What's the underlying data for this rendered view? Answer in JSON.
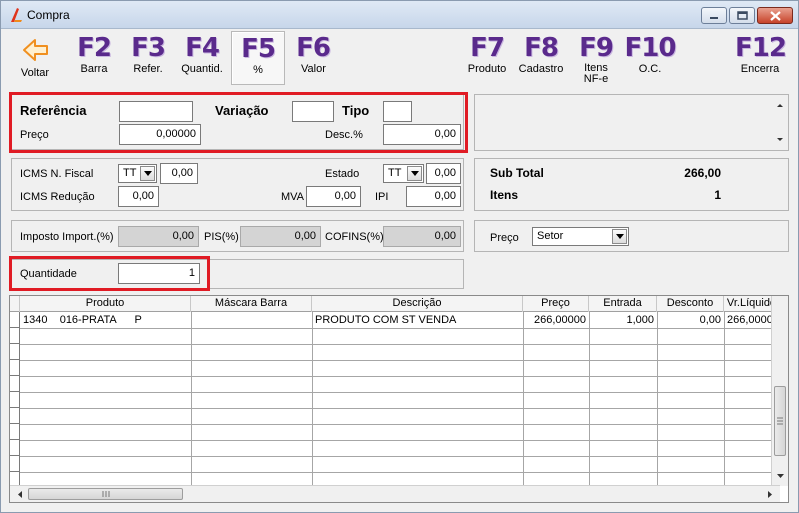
{
  "window": {
    "title": "Compra"
  },
  "toolbar": [
    {
      "key": "",
      "label": "Voltar"
    },
    {
      "key": "F2",
      "label": "Barra"
    },
    {
      "key": "F3",
      "label": "Refer."
    },
    {
      "key": "F4",
      "label": "Quantid."
    },
    {
      "key": "F5",
      "label": "%"
    },
    {
      "key": "F6",
      "label": "Valor"
    },
    {
      "key": "F7",
      "label": "Produto"
    },
    {
      "key": "F8",
      "label": "Cadastro"
    },
    {
      "key": "F9",
      "label": "Itens",
      "label2": "NF-e"
    },
    {
      "key": "F10",
      "label": "O.C."
    },
    {
      "key": "F12",
      "label": "Encerra"
    }
  ],
  "product": {
    "referencia_label": "Referência",
    "referencia_value": "",
    "variacao_label": "Variação",
    "variacao_value": "",
    "tipo_label": "Tipo",
    "tipo_value": "",
    "preco_label": "Preço",
    "preco_value": "0,00000",
    "desc_label": "Desc.%",
    "desc_value": "0,00"
  },
  "taxes": {
    "icms_nf_label": "ICMS N. Fiscal",
    "icms_nf_type": "TT",
    "icms_nf_value": "0,00",
    "estado_label": "Estado",
    "estado_type": "TT",
    "estado_value": "0,00",
    "icms_red_label": "ICMS Redução",
    "icms_red_value": "0,00",
    "mva_label": "MVA",
    "mva_value": "0,00",
    "ipi_label": "IPI",
    "ipi_value": "0,00"
  },
  "import": {
    "imposto_label": "Imposto Import.(%)",
    "imposto_value": "0,00",
    "pis_label": "PIS(%)",
    "pis_value": "0,00",
    "cofins_label": "COFINS(%)",
    "cofins_value": "0,00"
  },
  "quantity": {
    "label": "Quantidade",
    "value": "1"
  },
  "totals": {
    "subtotal_label": "Sub Total",
    "subtotal_value": "266,00",
    "itens_label": "Itens",
    "itens_value": "1"
  },
  "preco_select": {
    "label": "Preço",
    "value": "Setor"
  },
  "grid": {
    "columns": [
      "Produto",
      "Máscara Barra",
      "Descrição",
      "Preço",
      "Entrada",
      "Desconto",
      "Vr.Líquido"
    ],
    "rows": [
      {
        "produto": "1340    016-PRATA      P",
        "mascara": "",
        "descricao": "PRODUTO COM ST VENDA",
        "preco": "266,00000",
        "entrada": "1,000",
        "desconto": "0,00",
        "liquido": "266,00000"
      }
    ]
  }
}
